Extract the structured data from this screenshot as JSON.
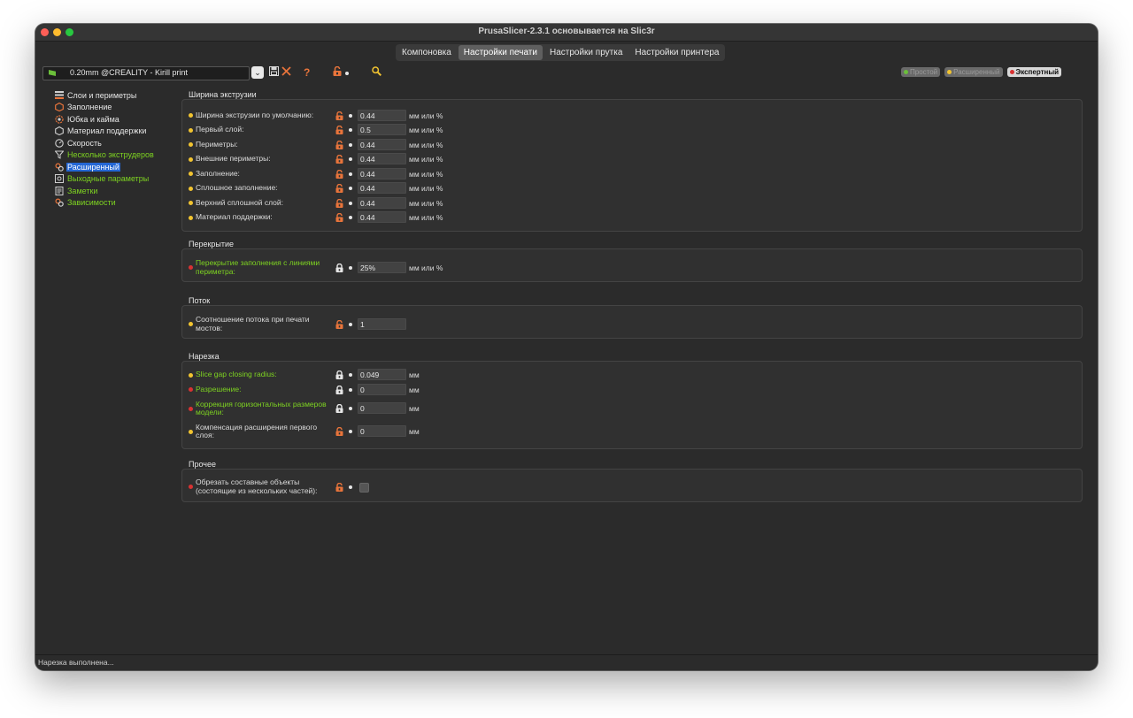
{
  "window": {
    "title": "PrusaSlicer-2.3.1 основывается на Slic3r"
  },
  "tabs": [
    {
      "label": "Компоновка"
    },
    {
      "label": "Настройки печати"
    },
    {
      "label": "Настройки прутка"
    },
    {
      "label": "Настройки принтера"
    }
  ],
  "preset": {
    "value": "0.20mm @CREALITY - Kirill print",
    "flag_color": "#6bbf3a"
  },
  "toolbar": {
    "help_glyph": "?"
  },
  "modes": [
    {
      "label": "Простой",
      "color": "#6bbf3a"
    },
    {
      "label": "Расширенный",
      "color": "#f2c430"
    },
    {
      "label": "Экспертный",
      "color": "#d93232"
    }
  ],
  "sidebar": {
    "items": [
      {
        "label": "Слои и периметры",
        "icon": "layers-icon",
        "color": "white"
      },
      {
        "label": "Заполнение",
        "icon": "infill-icon",
        "color": "white"
      },
      {
        "label": "Юбка и кайма",
        "icon": "skirt-icon",
        "color": "white"
      },
      {
        "label": "Материал поддержки",
        "icon": "support-icon",
        "color": "white"
      },
      {
        "label": "Скорость",
        "icon": "speed-icon",
        "color": "white"
      },
      {
        "label": "Несколько экструдеров",
        "icon": "funnel-icon",
        "color": "green"
      },
      {
        "label": "Расширенный",
        "icon": "cog-icon",
        "color": "white"
      },
      {
        "label": "Выходные параметры",
        "icon": "output-icon",
        "color": "green"
      },
      {
        "label": "Заметки",
        "icon": "notes-icon",
        "color": "green"
      },
      {
        "label": "Зависимости",
        "icon": "deps-icon",
        "color": "green"
      }
    ]
  },
  "sections": [
    {
      "title": "Ширина экструзии",
      "rows": [
        {
          "label": "Ширина экструзии по умолчанию:",
          "value": "0.44",
          "unit": "мм или %",
          "dot": "yellow",
          "label_color": "white",
          "lock": "open"
        },
        {
          "label": "Первый слой:",
          "value": "0.5",
          "unit": "мм или %",
          "dot": "yellow",
          "label_color": "white",
          "lock": "open"
        },
        {
          "label": "Периметры:",
          "value": "0.44",
          "unit": "мм или %",
          "dot": "yellow",
          "label_color": "white",
          "lock": "open"
        },
        {
          "label": "Внешние периметры:",
          "value": "0.44",
          "unit": "мм или %",
          "dot": "yellow",
          "label_color": "white",
          "lock": "open"
        },
        {
          "label": "Заполнение:",
          "value": "0.44",
          "unit": "мм или %",
          "dot": "yellow",
          "label_color": "white",
          "lock": "open"
        },
        {
          "label": "Сплошное заполнение:",
          "value": "0.44",
          "unit": "мм или %",
          "dot": "yellow",
          "label_color": "white",
          "lock": "open"
        },
        {
          "label": "Верхний сплошной слой:",
          "value": "0.44",
          "unit": "мм или %",
          "dot": "yellow",
          "label_color": "white",
          "lock": "open"
        },
        {
          "label": "Материал поддержки:",
          "value": "0.44",
          "unit": "мм или %",
          "dot": "yellow",
          "label_color": "white",
          "lock": "open"
        }
      ]
    },
    {
      "title": "Перекрытие",
      "rows": [
        {
          "label": "Перекрытие заполнения с линиями периметра:",
          "value": "25%",
          "unit": "мм или %",
          "dot": "red",
          "label_color": "green",
          "lock": "closed"
        }
      ]
    },
    {
      "title": "Поток",
      "rows": [
        {
          "label": "Соотношение потока при печати мостов:",
          "value": "1",
          "unit": "",
          "dot": "yellow",
          "label_color": "white",
          "lock": "open"
        }
      ]
    },
    {
      "title": "Нарезка",
      "rows": [
        {
          "label": "Slice gap closing radius:",
          "value": "0.049",
          "unit": "мм",
          "dot": "yellow",
          "label_color": "green",
          "lock": "closed"
        },
        {
          "label": "Разрешение:",
          "value": "0",
          "unit": "мм",
          "dot": "red",
          "label_color": "green",
          "lock": "closed"
        },
        {
          "label": "Коррекция горизонтальных размеров модели:",
          "value": "0",
          "unit": "мм",
          "dot": "red",
          "label_color": "green",
          "lock": "closed"
        },
        {
          "label": "Компенсация расширения первого слоя:",
          "value": "0",
          "unit": "мм",
          "dot": "yellow",
          "label_color": "white",
          "lock": "open"
        }
      ]
    },
    {
      "title": "Прочее",
      "rows": [
        {
          "label": "Обрезать составные объекты (состоящие из нескольких частей):",
          "value": "",
          "unit": "",
          "dot": "red",
          "label_color": "white",
          "lock": "open",
          "checkbox": true
        }
      ]
    }
  ],
  "status": {
    "text": "Нарезка выполнена..."
  },
  "colors": {
    "accent": "#2467d4",
    "lock_open": "#e8743b",
    "lock_closed": "#e6e6e6",
    "green_label": "#7ed321"
  }
}
